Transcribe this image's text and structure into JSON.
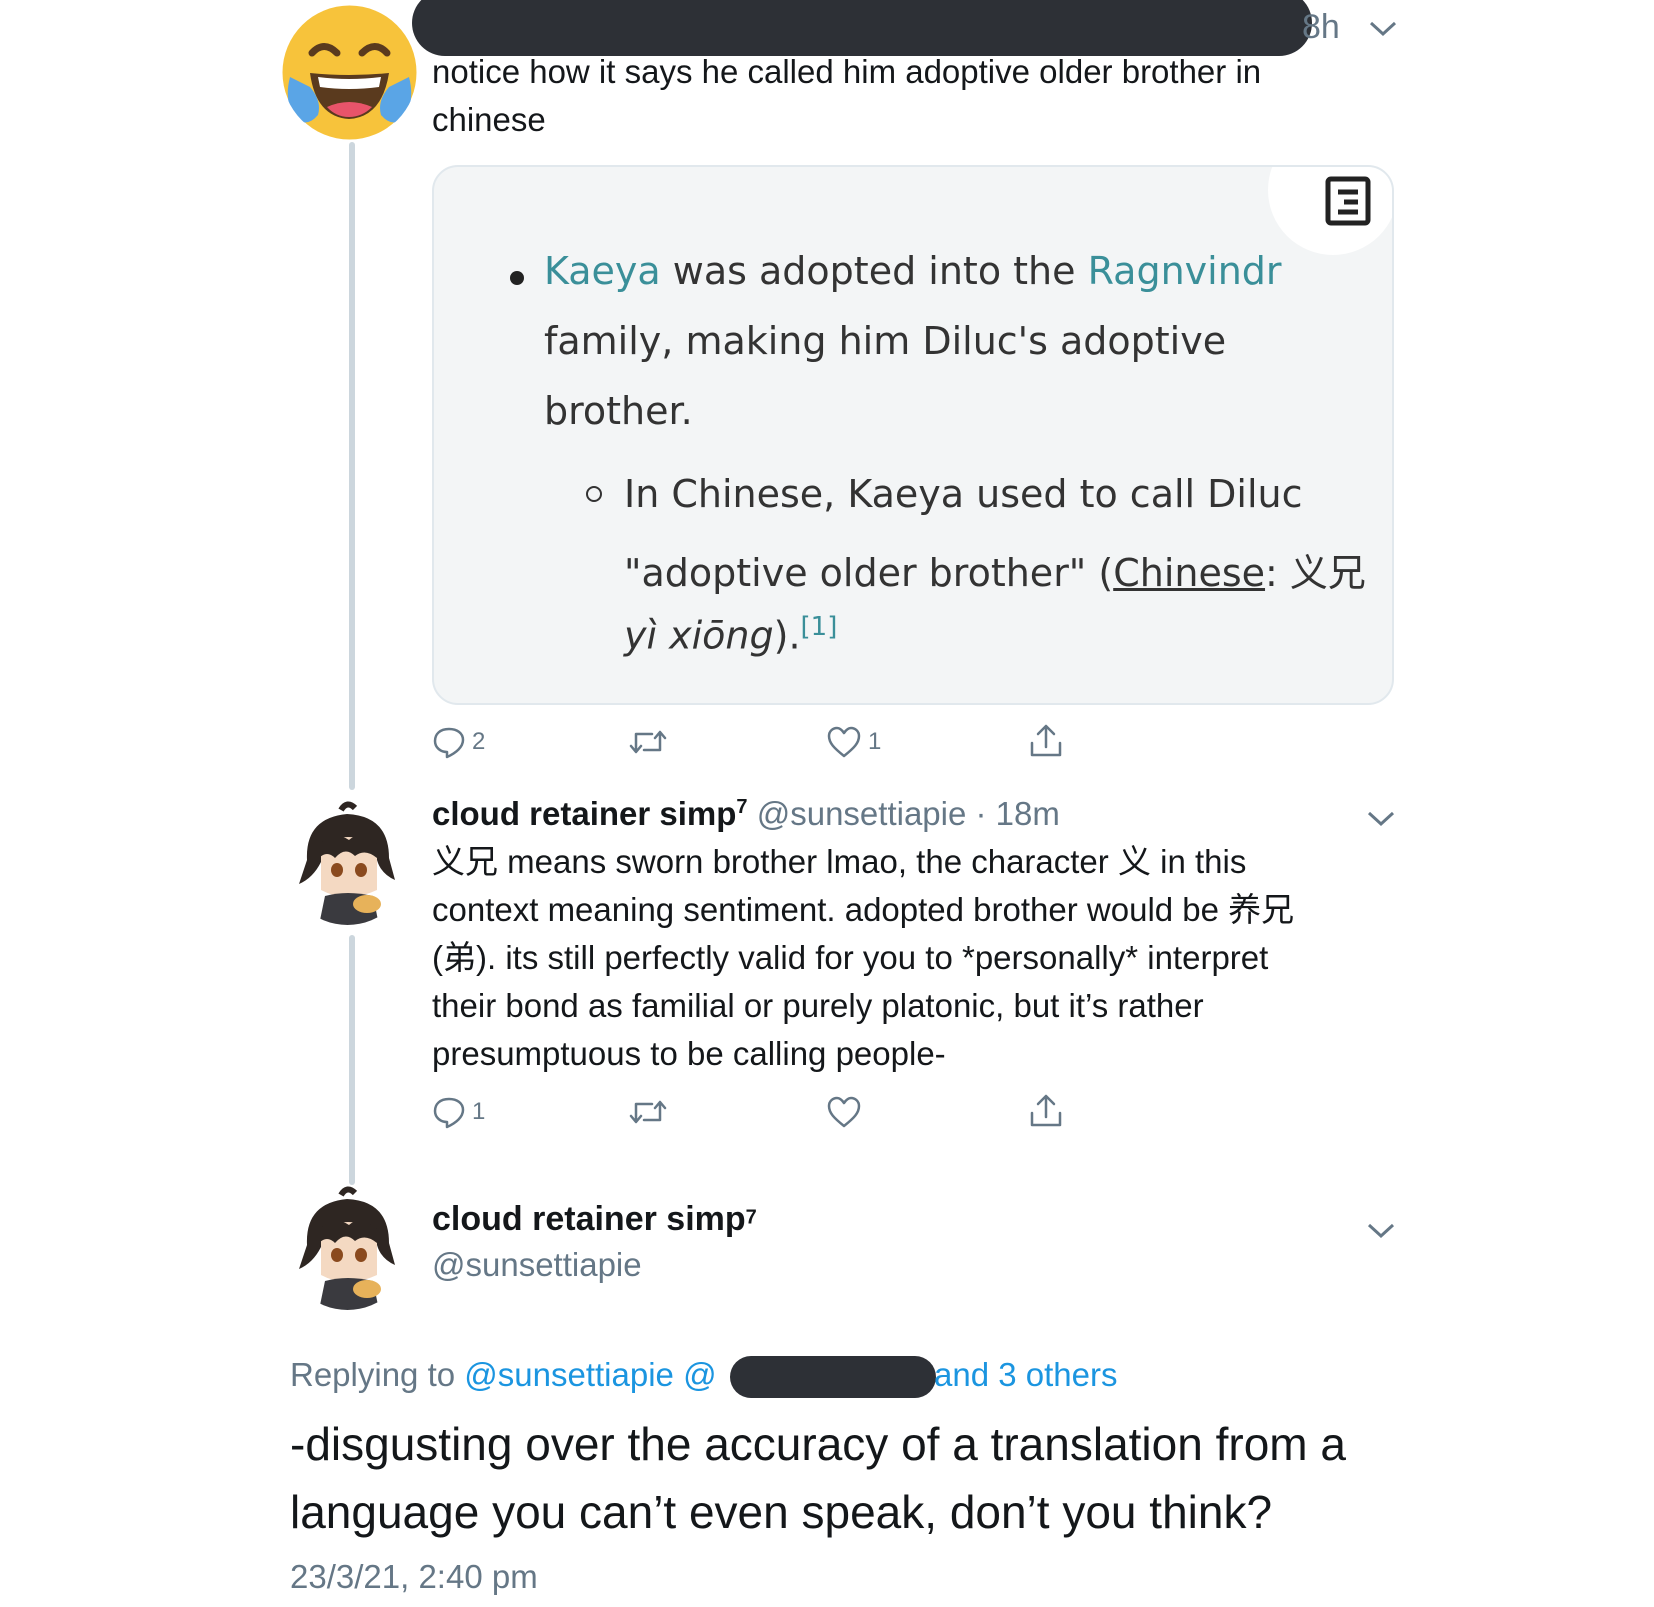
{
  "tweet1": {
    "time": "8h",
    "text_line1": "notice how it says he called him adoptive older brother in",
    "text_line2": "chinese",
    "card": {
      "bullet_link1": "Kaeya",
      "bullet_text1": " was adopted into the ",
      "bullet_link2": "Ragnvindr",
      "bullet_line2": "family, making him Diluc's adoptive",
      "bullet_line3": "brother.",
      "sub_line1": "In Chinese, Kaeya used to call Diluc",
      "sub_line2_a": "\"adoptive older brother\" (",
      "sub_line2_link": "Chinese",
      "sub_line2_b": ": 义兄",
      "sub_line3_italic": "yì xiōng",
      "sub_line3_end": ").",
      "sub_ref": "[1]"
    },
    "actions": {
      "reply_count": "2",
      "retweet_count": "",
      "like_count": "1"
    }
  },
  "tweet2": {
    "name": "cloud retainer simp",
    "name_sup": "7",
    "handle": "@sunsettiapie",
    "time": "· 18m",
    "lines": [
      "义兄 means sworn brother lmao, the character 义 in this",
      "context meaning sentiment. adopted brother would be 养兄",
      "(弟). its still perfectly valid for you to *personally* interpret",
      "their bond as familial or purely platonic, but it’s rather",
      "presumptuous to be calling people-"
    ],
    "actions": {
      "reply_count": "1",
      "retweet_count": "",
      "like_count": ""
    }
  },
  "tweet3": {
    "name": "cloud retainer simp",
    "name_sup": "7",
    "handle": "@sunsettiapie",
    "replying_prefix": "Replying to ",
    "replying_handle": "@sunsettiapie",
    "replying_handle2": "@",
    "replying_others": "and 3 others",
    "line1": "-disgusting over the accuracy of a translation from a",
    "line2": "language you can’t even speak, don’t you think?",
    "timestamp": "23/3/21, 2:40 pm"
  },
  "colors": {
    "link": "#3a8f99",
    "twitter_blue": "#1b95e0",
    "meta_gray": "#657786"
  }
}
